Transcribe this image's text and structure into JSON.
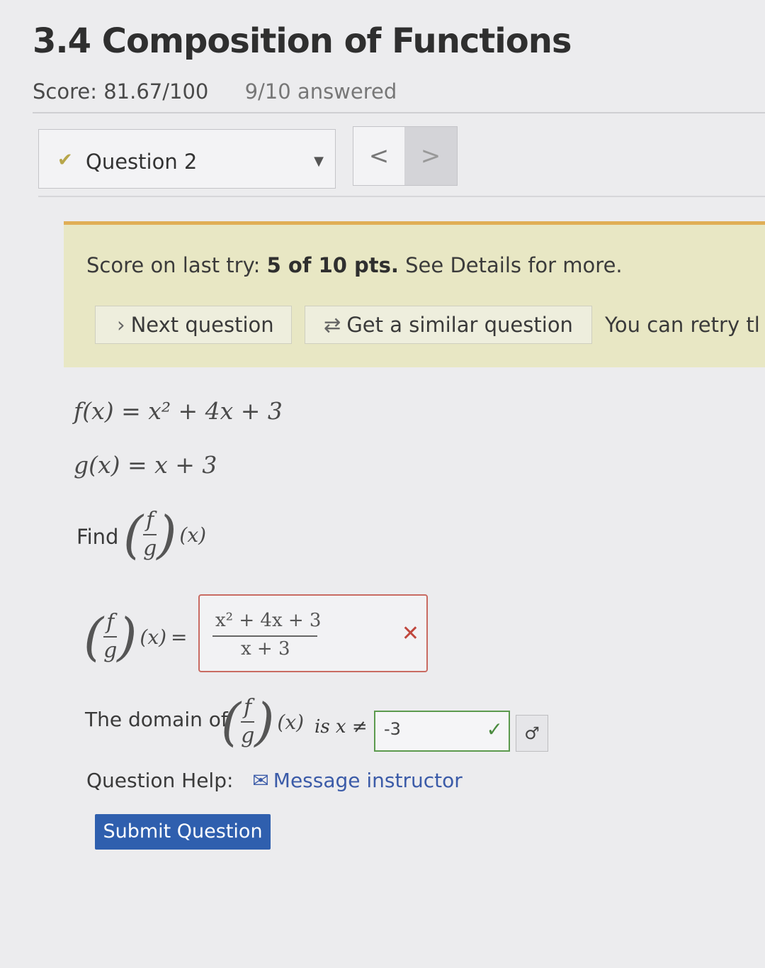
{
  "header": {
    "title": "3.4 Composition of Functions",
    "score": "Score: 81.67/100",
    "answered": "9/10 answered"
  },
  "question_nav": {
    "selected": "Question 2",
    "prev": "<",
    "next": ">"
  },
  "banner": {
    "prefix": "Score on last try: ",
    "points": "5 of 10 pts.",
    "suffix": " See Details for more.",
    "next_question": "Next question",
    "similar_question": "Get a similar question",
    "retry_text": "You can retry tl"
  },
  "problem": {
    "f_def": "f(x) = x² + 4x + 3",
    "g_def": "g(x) = x + 3",
    "find_label": "Find",
    "frac_num": "f",
    "frac_den": "g",
    "arg": "(x)",
    "equals": "="
  },
  "answer": {
    "numerator": "x² + 4x + 3",
    "denominator": "x + 3",
    "status": "incorrect"
  },
  "domain": {
    "label": "The domain of",
    "is_text": "is x ≠",
    "value": "-3",
    "status": "correct"
  },
  "help": {
    "label": "Question Help:",
    "message_instructor": "Message instructor"
  },
  "submit_label": "Submit Question",
  "colors": {
    "banner_bg": "#e8e7c4",
    "banner_border": "#e0ae56",
    "incorrect": "#c96b62",
    "correct": "#5c9a4e",
    "submit_bg": "#2f5fae",
    "link": "#3b5ba8"
  },
  "icons": {
    "question_status": "check-icon",
    "dropdown": "caret-down-icon",
    "next_question": "chevron-right-icon",
    "similar": "refresh-icon",
    "wrong": "x-icon",
    "right": "check-icon",
    "keyboard": "math-keyboard-icon",
    "envelope": "envelope-icon"
  }
}
